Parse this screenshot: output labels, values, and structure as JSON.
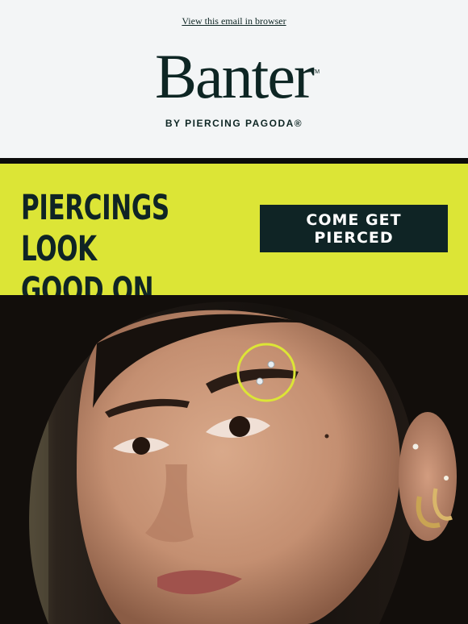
{
  "header": {
    "view_in_browser": "View this email in browser",
    "logo_word": "Banter",
    "logo_tm": "TM",
    "logo_sub": "BY PIERCING PAGODA®"
  },
  "banner": {
    "headline_line1": "PIERCINGS LOOK",
    "headline_line2": "GOOD ON YOU",
    "cta_label": "COME GET PIERCED"
  },
  "hero": {
    "image_alt": "Close-up of woman with eyebrow piercing and ear jewelry"
  },
  "colors": {
    "brand_dark": "#0f2425",
    "banner_yellow": "#dce536",
    "header_bg": "#f3f5f6"
  }
}
